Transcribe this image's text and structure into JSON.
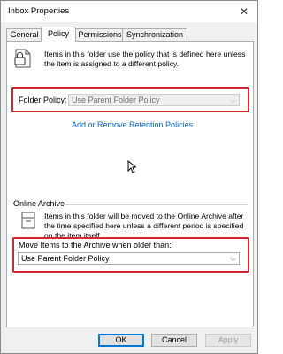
{
  "window": {
    "title": "Inbox Properties",
    "close_glyph": "✕"
  },
  "tabs": [
    {
      "label": "General"
    },
    {
      "label": "Policy"
    },
    {
      "label": "Permissions"
    },
    {
      "label": "Synchronization"
    }
  ],
  "policy": {
    "info_text": "Items in this folder use the policy that is defined here unless the item is assigned to a different policy.",
    "folder_policy_label": "Folder Policy:",
    "folder_policy_value": "Use Parent Folder Policy",
    "link_text": "Add or Remove Retention Policies"
  },
  "archive": {
    "section_title": "Online Archive",
    "info_text": "Items in this folder will be moved to the Online Archive after the time specified here unless a different period is specified on the item itself.",
    "move_label": "Move Items to the Archive when older than:",
    "move_value": "Use Parent Folder Policy"
  },
  "buttons": {
    "ok": "OK",
    "cancel": "Cancel",
    "apply": "Apply"
  },
  "colors": {
    "highlight_box": "#d9262e",
    "link": "#0066cc",
    "default_button_border": "#0078d7"
  }
}
